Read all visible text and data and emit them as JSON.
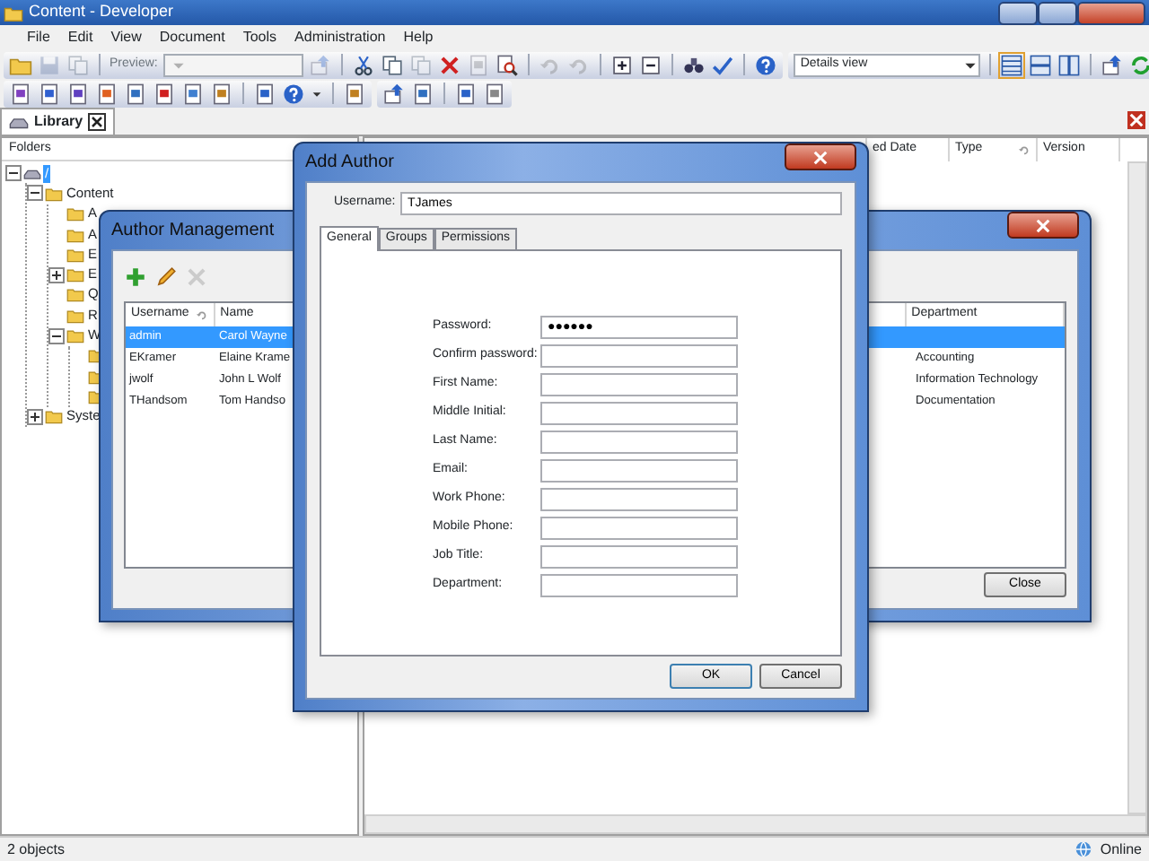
{
  "window": {
    "title": "Content - Developer"
  },
  "menu": [
    "File",
    "Edit",
    "View",
    "Document",
    "Tools",
    "Administration",
    "Help"
  ],
  "toolbar": {
    "preview_label": "Preview:",
    "view_select": "Details view"
  },
  "library_tab": {
    "label": "Library",
    "selected": true
  },
  "folders": {
    "heading": "Folders",
    "tree": [
      {
        "label": "/",
        "selected": true,
        "expanded": true,
        "children": [
          {
            "label": "Content",
            "selected": false,
            "expanded": true,
            "children": [
              {
                "label": "A",
                "selected": false
              },
              {
                "label": "A",
                "selected": false
              },
              {
                "label": "E",
                "selected": false
              },
              {
                "label": "E",
                "selected": false,
                "expanded": false
              },
              {
                "label": "Q",
                "selected": false
              },
              {
                "label": "R",
                "selected": false
              },
              {
                "label": "W",
                "selected": false,
                "expanded": true,
                "children": [
                  {
                    "selected": false
                  },
                  {
                    "selected": false
                  },
                  {
                    "selected": false
                  }
                ]
              }
            ]
          },
          {
            "label": "Syste",
            "selected": false,
            "expanded": false
          }
        ]
      }
    ]
  },
  "content_list": {
    "columns": [
      {
        "label": "ed Date",
        "sorted": false
      },
      {
        "label": "Type",
        "sorted": true
      },
      {
        "label": "Version",
        "sorted": false
      }
    ]
  },
  "author_management": {
    "title": "Author Management",
    "columns": [
      {
        "label": "Username",
        "sorted": true
      },
      {
        "label": "Name",
        "sorted": false
      },
      {
        "label": "Department",
        "sorted": false
      }
    ],
    "rows": [
      {
        "username": "admin",
        "name": "Carol Wayne",
        "selected": true
      },
      {
        "username": "EKramer",
        "name": "Elaine Krame",
        "department": "Accounting",
        "selected": false
      },
      {
        "username": "jwolf",
        "name": "John L Wolf",
        "department": "Information Technology",
        "selected": false
      },
      {
        "username": "THandsom",
        "name": "Tom Handso",
        "department": "Documentation",
        "selected": false
      }
    ],
    "close_button": "Close"
  },
  "add_author": {
    "title": "Add Author",
    "username_label": "Username:",
    "username": "TJames",
    "tabs": [
      {
        "label": "General",
        "selected": true
      },
      {
        "label": "Groups",
        "selected": false
      },
      {
        "label": "Permissions",
        "selected": false
      }
    ],
    "fields": [
      {
        "label": "Password:",
        "value": "●●●●●●"
      },
      {
        "label": "Confirm password:"
      },
      {
        "label": "First Name:"
      },
      {
        "label": "Middle Initial:"
      },
      {
        "label": "Last Name:"
      },
      {
        "label": "Email:"
      },
      {
        "label": "Work Phone:"
      },
      {
        "label": "Mobile Phone:"
      },
      {
        "label": "Job Title:"
      },
      {
        "label": "Department:"
      }
    ],
    "buttons": [
      "OK",
      "Cancel"
    ]
  },
  "status_bar": {
    "count": "2 objects",
    "connection": "Online"
  }
}
